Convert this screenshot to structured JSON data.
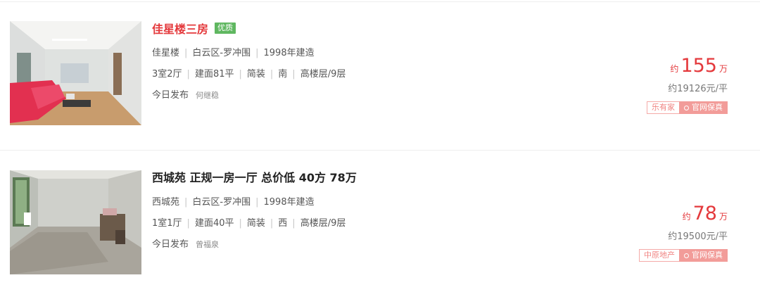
{
  "listings": [
    {
      "title": "佳星楼三房",
      "badge": "优质",
      "community": "佳星楼",
      "district": "白云区-罗冲围",
      "built": "1998年建造",
      "layout": "3室2厅",
      "area": "建面81平",
      "decoration": "简装",
      "orientation": "南",
      "floor": "高楼层/9层",
      "posted": "今日发布",
      "agent": "何继稳",
      "price_prefix": "约",
      "price": "155",
      "price_unit": "万",
      "unit_price": "约19126元/平",
      "agency": "乐有家",
      "guarantee": "官网保真"
    },
    {
      "title": "西城苑 正规一房一厅 总价低 40方 78万",
      "community": "西城苑",
      "district": "白云区-罗冲围",
      "built": "1998年建造",
      "layout": "1室1厅",
      "area": "建面40平",
      "decoration": "简装",
      "orientation": "西",
      "floor": "高楼层/9层",
      "posted": "今日发布",
      "agent": "曾福泉",
      "price_prefix": "约",
      "price": "78",
      "price_unit": "万",
      "unit_price": "约19500元/平",
      "agency": "中原地产",
      "guarantee": "官网保真"
    }
  ],
  "colors": {
    "accent": "#e4393c",
    "badge": "#5fb760",
    "tag": "#f29c99"
  }
}
